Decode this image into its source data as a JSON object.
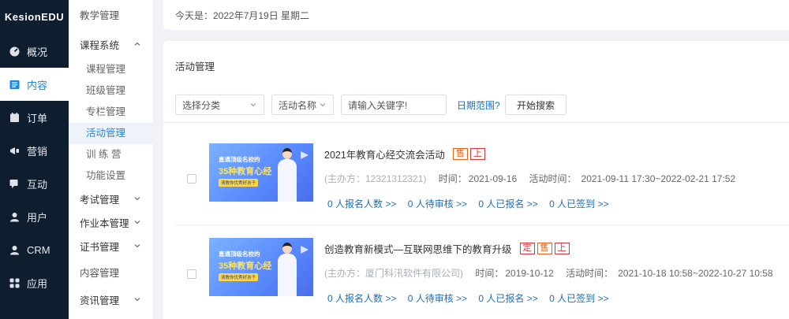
{
  "app": {
    "logo": "KesionEDU"
  },
  "sidebar": {
    "items": [
      {
        "label": "概况",
        "icon": "dashboard-icon"
      },
      {
        "label": "内容",
        "icon": "content-icon",
        "active": true
      },
      {
        "label": "订单",
        "icon": "order-icon"
      },
      {
        "label": "营销",
        "icon": "marketing-icon"
      },
      {
        "label": "互动",
        "icon": "chat-icon"
      },
      {
        "label": "用户",
        "icon": "user-icon"
      },
      {
        "label": "CRM",
        "icon": "crm-icon"
      },
      {
        "label": "应用",
        "icon": "apps-icon"
      }
    ],
    "active_color": "#1e88e5",
    "background": "#0e1e2f"
  },
  "subnav": {
    "top": "教学管理",
    "course_group": "课程系统",
    "course_items": [
      "课程管理",
      "班级管理",
      "专栏管理",
      "活动管理",
      "训 练 营",
      "功能设置"
    ],
    "current": "活动管理",
    "exam": "考试管理",
    "homework": "作业本管理",
    "certificate": "证书管理",
    "content_mgmt": "内容管理",
    "news": "资讯管理"
  },
  "header": {
    "date_text": "今天是：2022年7月19日 星期二"
  },
  "panel": {
    "title": "活动管理",
    "filters": {
      "category": "选择分类",
      "field": "活动名称",
      "keyword_placeholder": "请输入关键字!",
      "date_range": "日期范围?",
      "search": "开始搜索"
    }
  },
  "activities": [
    {
      "thumb": {
        "line1": "直通顶级名校的",
        "line2": "35种教育心经",
        "line3": "清教你优秀好孩子"
      },
      "title": "2021年教育心经交流会活动",
      "tags": [
        {
          "text": "售",
          "color": "#e0641c"
        },
        {
          "text": "上",
          "color": "#d9363e"
        }
      ],
      "sponsor": "(主办方：12321312321)",
      "time_label": "时间：",
      "time": "2021-09-16",
      "period_label": "活动时间：",
      "period": "2021-09-11 17:30~2022-02-21 17:52",
      "links": [
        "0 人报名人数 >>",
        "0 人待审核 >>",
        "0 人已报名 >>",
        "0 人已签到 >>"
      ]
    },
    {
      "thumb": {
        "line1": "直通顶级名校的",
        "line2": "35种教育心经",
        "line3": "清教你优秀好孩子"
      },
      "title": "创造教育新模式—互联网思维下的教育升级",
      "tags": [
        {
          "text": "定",
          "color": "#d9363e"
        },
        {
          "text": "售",
          "color": "#e0641c"
        },
        {
          "text": "上",
          "color": "#d9363e"
        }
      ],
      "sponsor": "(主办方：厦门科汛软件有限公司)",
      "time_label": "时间：",
      "time": "2019-10-12",
      "period_label": "活动时间：",
      "period": "2021-10-18 10:58~2022-10-27 10:58",
      "links": [
        "0 人报名人数 >>",
        "0 人待审核 >>",
        "0 人已报名 >>",
        "0 人已签到 >>"
      ]
    }
  ]
}
